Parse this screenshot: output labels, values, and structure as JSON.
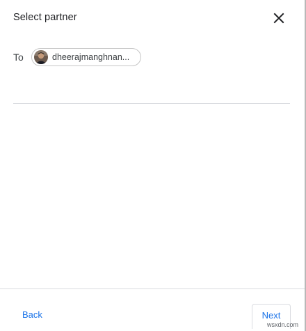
{
  "dialog": {
    "title": "Select partner",
    "close_icon": "close-icon",
    "to_label": "To",
    "recipient_chip": {
      "label": "dheerajmanghnan...",
      "avatar_icon": "avatar-photo"
    },
    "footer": {
      "back_label": "Back",
      "next_label": "Next"
    }
  },
  "watermark": "wsxdn.com",
  "colors": {
    "accent": "#1a73e8",
    "text": "#202124",
    "divider": "#dadce0"
  }
}
